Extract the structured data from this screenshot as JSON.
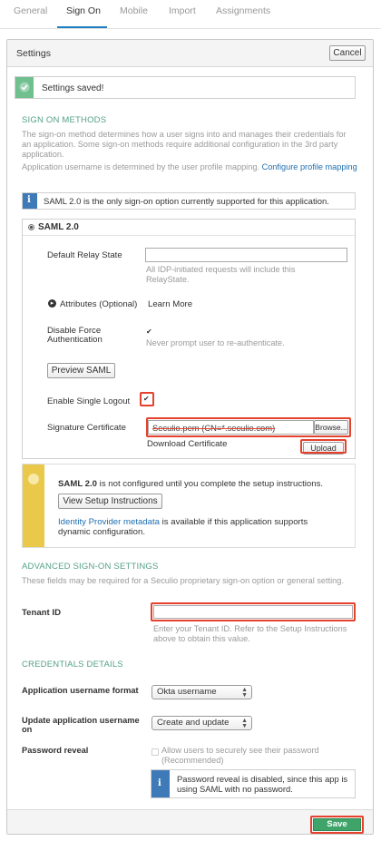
{
  "tabs": [
    {
      "label": "General"
    },
    {
      "label": "Sign On"
    },
    {
      "label": "Mobile"
    },
    {
      "label": "Import"
    },
    {
      "label": "Assignments"
    }
  ],
  "settings": {
    "title": "Settings",
    "cancel_label": "Cancel"
  },
  "success_message": "Settings saved!",
  "sign_on_methods": {
    "heading": "SIGN ON METHODS",
    "description": "The sign-on method determines how a user signs into and manages their credentials for an application. Some sign-on methods require additional configuration in the 3rd party application.",
    "mapping_text": "Application username is determined by the user profile mapping.",
    "mapping_link": "Configure profile mapping",
    "info_text": "SAML 2.0 is the only sign-on option currently supported for this application."
  },
  "saml": {
    "title": "SAML 2.0",
    "relay_state_label": "Default Relay State",
    "relay_state_value": "",
    "relay_state_hint": "All IDP-initiated requests will include this RelayState.",
    "attributes_label": "Attributes (Optional)",
    "learn_more": "Learn More",
    "disable_force_label": "Disable Force Authentication",
    "disable_force_checked": true,
    "disable_force_hint": "Never prompt user to re-authenticate.",
    "preview_button": "Preview SAML",
    "single_logout_label": "Enable Single Logout",
    "single_logout_checked": true,
    "signature_label": "Signature Certificate",
    "signature_file": "Seculio.pem (CN=*.seculio.com)",
    "browse_label": "Browse...",
    "download_cert": "Download Certificate",
    "upload_label": "Upload"
  },
  "setup_notice": {
    "strong": "SAML 2.0",
    "text": " is not configured until you complete the setup instructions.",
    "button": "View Setup Instructions",
    "metadata_link": "Identity Provider metadata",
    "metadata_text": " is available if this application supports dynamic configuration."
  },
  "advanced": {
    "heading": "ADVANCED SIGN-ON SETTINGS",
    "description": "These fields may be required for a Seculio proprietary sign-on option or general setting.",
    "tenant_label": "Tenant ID",
    "tenant_value": "",
    "tenant_hint": "Enter your Tenant ID. Refer to the Setup Instructions above to obtain this value."
  },
  "credentials": {
    "heading": "CREDENTIALS DETAILS",
    "username_format_label": "Application username format",
    "username_format_value": "Okta username",
    "update_label": "Update application username on",
    "update_value": "Create and update",
    "password_reveal_label": "Password reveal",
    "password_reveal_option": "Allow users to securely see their password (Recommended)",
    "password_reveal_info": "Password reveal is disabled, since this app is using SAML with no password."
  },
  "footer": {
    "save_label": "Save"
  },
  "colors": {
    "accent_green": "#55a08a",
    "link_blue": "#1f6fb0",
    "highlight_red": "#e5412d",
    "save_green": "#3fa46a",
    "warning_yellow": "#e9c84a"
  }
}
